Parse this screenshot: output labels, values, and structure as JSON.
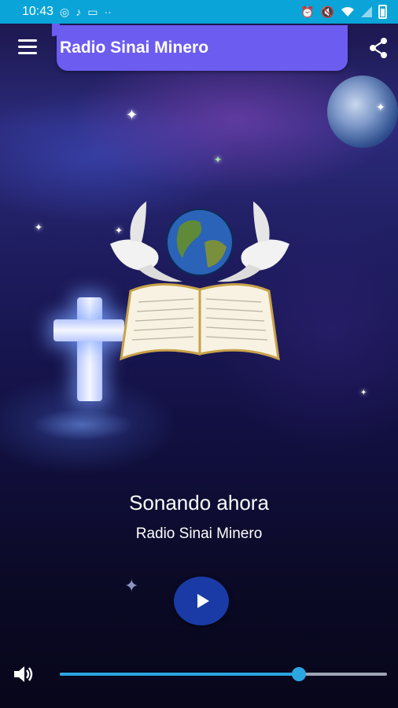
{
  "status_bar": {
    "time": "10:43",
    "left_icons": [
      "whatsapp-icon",
      "music-note-icon",
      "cast-icon",
      "more-dots-icon"
    ],
    "right_icons": [
      "alarm-icon",
      "mute-icon",
      "wifi-icon",
      "signal-icon",
      "battery-icon"
    ]
  },
  "app_bar": {
    "title": "Radio Sinai Minero",
    "menu_icon": "hamburger-menu-icon",
    "share_icon": "share-icon"
  },
  "player": {
    "heading": "Sonando ahora",
    "station": "Radio Sinai Minero",
    "play_icon": "play-icon",
    "volume_icon": "volume-icon",
    "volume_level": 0.73
  },
  "colors": {
    "status_bar": "#0aa4d8",
    "title_box": "#6c5cf0",
    "play_button": "#1a3ba6",
    "accent": "#2aa6e0"
  }
}
